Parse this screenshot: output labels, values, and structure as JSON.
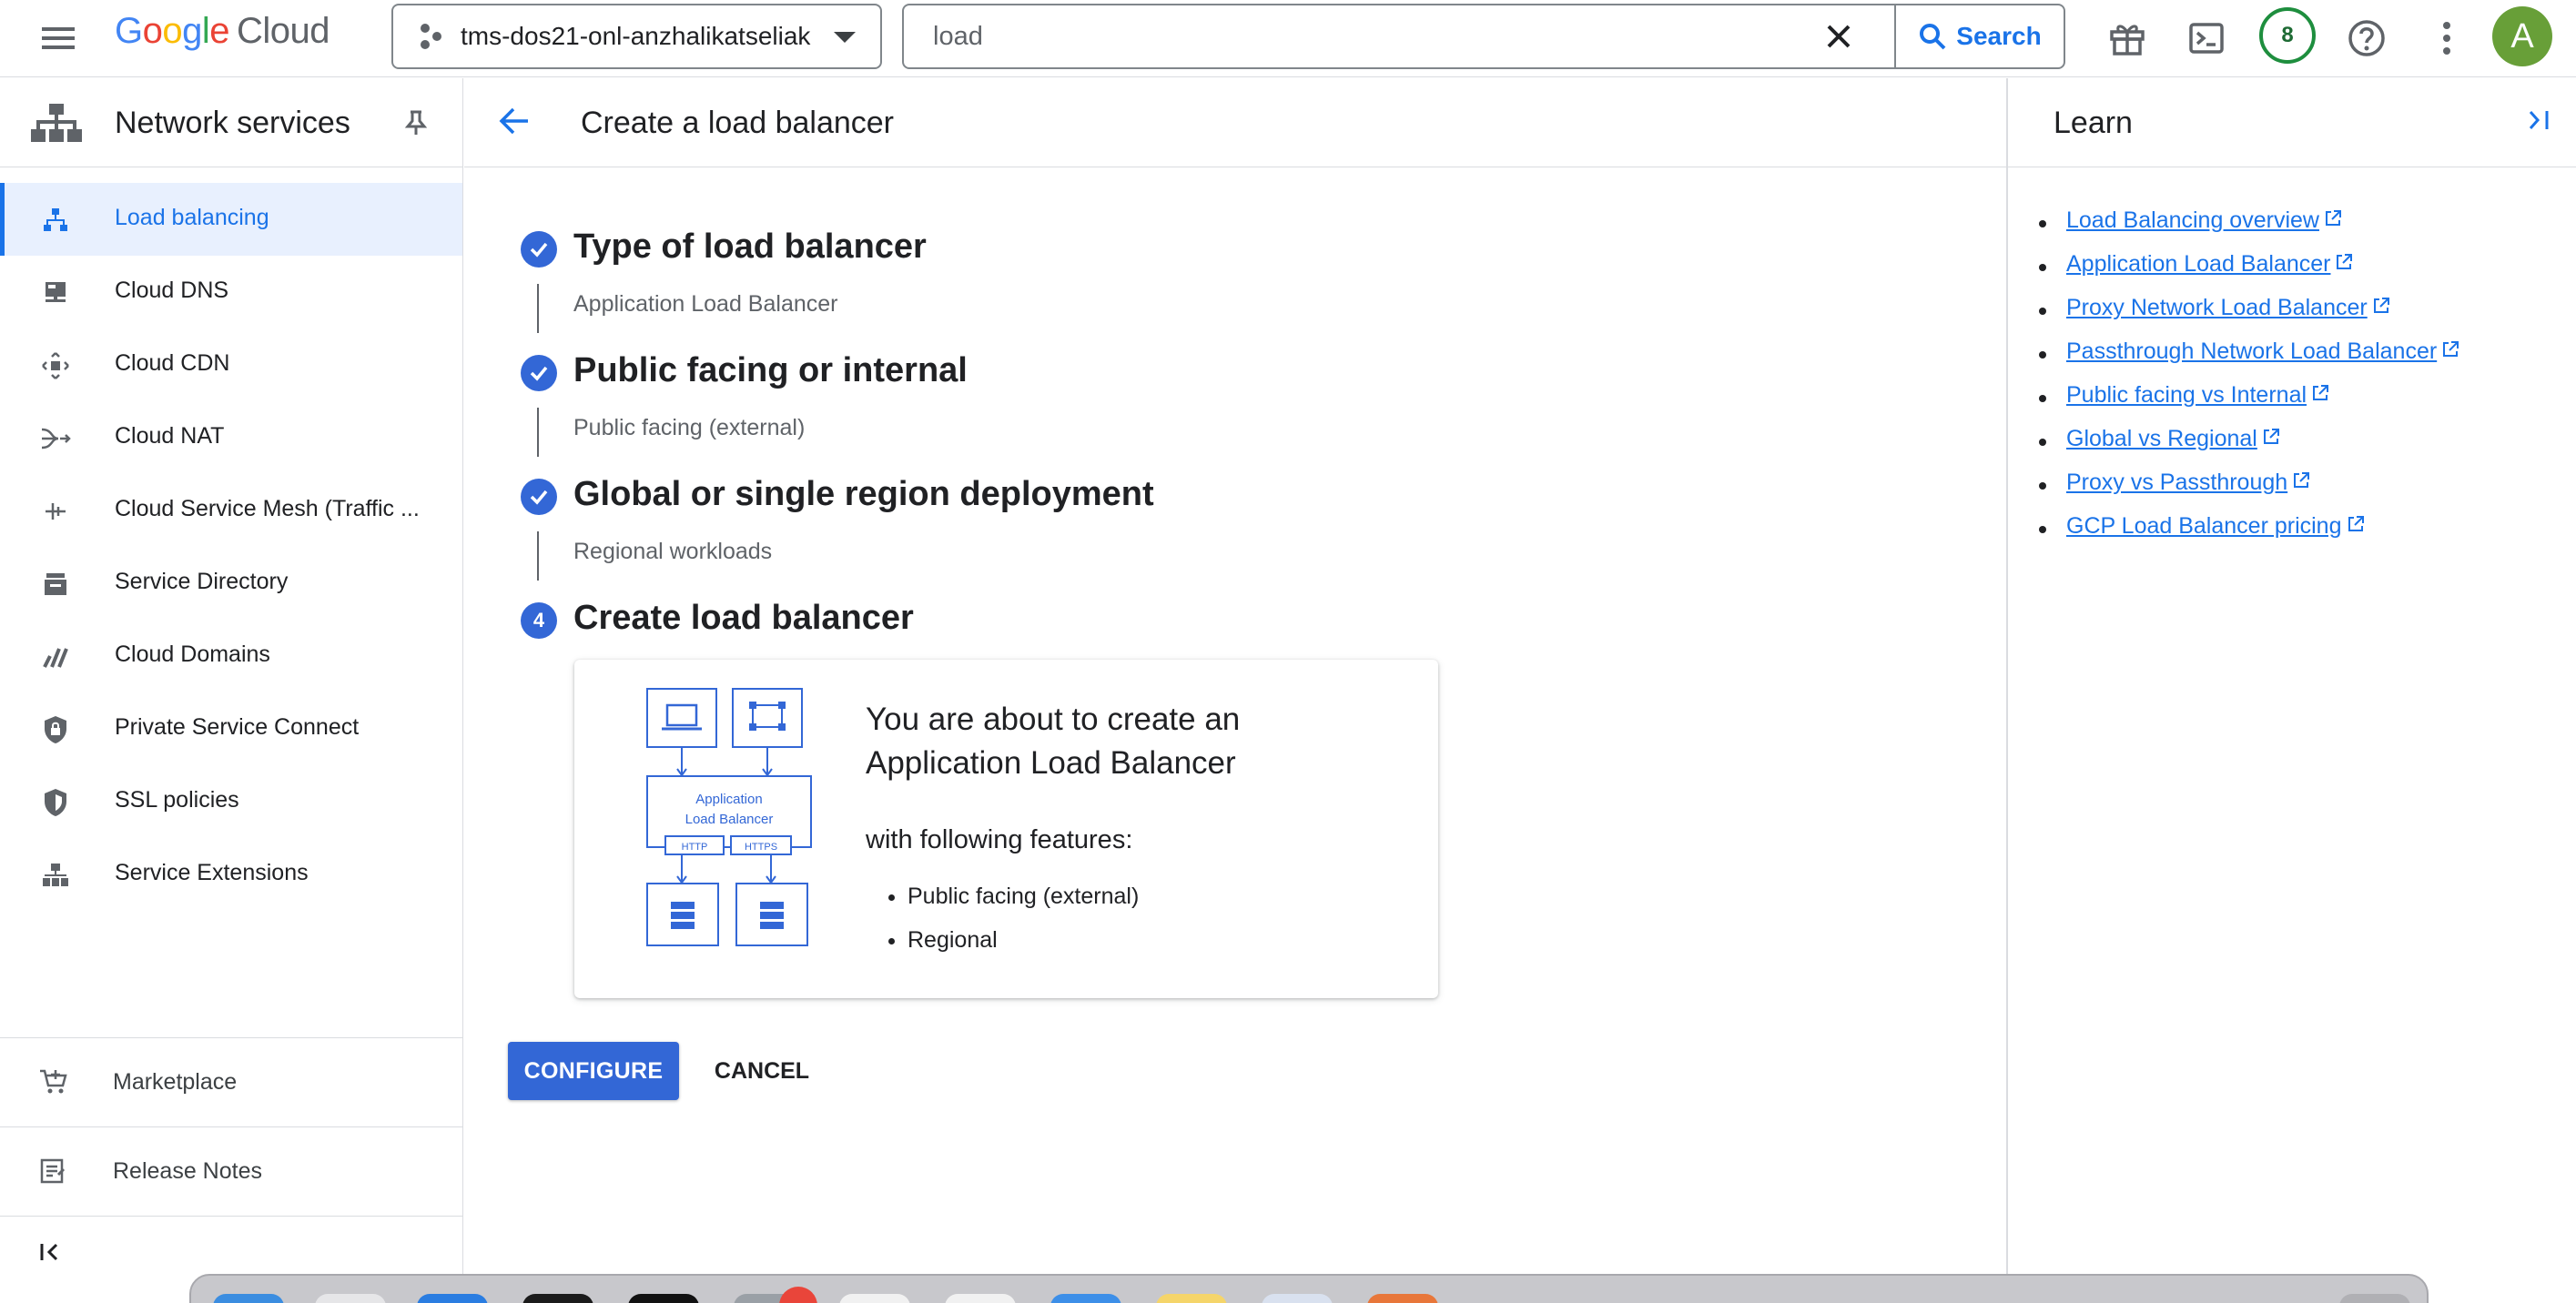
{
  "topbar": {
    "logo_letters": [
      "G",
      "o",
      "o",
      "g",
      "l",
      "e"
    ],
    "logo_suffix": "Cloud",
    "project_name": "tms-dos21-onl-anzhalikatseliak",
    "search_value": "load",
    "search_button": "Search",
    "notification_count": "8",
    "avatar_letter": "A"
  },
  "leftnav": {
    "title": "Network services",
    "items": [
      {
        "label": "Load balancing",
        "icon": "load-balancing-icon",
        "active": true
      },
      {
        "label": "Cloud DNS",
        "icon": "cloud-dns-icon"
      },
      {
        "label": "Cloud CDN",
        "icon": "cloud-cdn-icon"
      },
      {
        "label": "Cloud NAT",
        "icon": "cloud-nat-icon"
      },
      {
        "label": "Cloud Service Mesh (Traffic ...",
        "icon": "service-mesh-icon"
      },
      {
        "label": "Service Directory",
        "icon": "service-directory-icon"
      },
      {
        "label": "Cloud Domains",
        "icon": "cloud-domains-icon"
      },
      {
        "label": "Private Service Connect",
        "icon": "private-service-connect-icon"
      },
      {
        "label": "SSL policies",
        "icon": "ssl-policies-icon"
      },
      {
        "label": "Service Extensions",
        "icon": "service-extensions-icon"
      }
    ],
    "marketplace": "Marketplace",
    "release_notes": "Release Notes"
  },
  "main": {
    "title": "Create a load balancer",
    "steps": [
      {
        "title": "Type of load balancer",
        "subtitle": "Application Load Balancer",
        "status": "done"
      },
      {
        "title": "Public facing or internal",
        "subtitle": "Public facing (external)",
        "status": "done"
      },
      {
        "title": "Global or single region deployment",
        "subtitle": "Regional workloads",
        "status": "done"
      },
      {
        "title": "Create load balancer",
        "number": "4",
        "status": "current"
      }
    ],
    "card": {
      "title": "You are about to create an Application Load Balancer",
      "features_label": "with following features:",
      "features": [
        "Public facing (external)",
        "Regional"
      ],
      "diagram": {
        "lb_line1": "Application",
        "lb_line2": "Load Balancer",
        "proto1": "HTTP",
        "proto2": "HTTPS"
      }
    },
    "configure_button": "CONFIGURE",
    "cancel_button": "CANCEL"
  },
  "learn": {
    "title": "Learn",
    "links": [
      "Load Balancing overview",
      "Application Load Balancer",
      "Proxy Network Load Balancer",
      "Passthrough Network Load Balancer",
      "Public facing vs Internal",
      "Global vs Regional",
      "Proxy vs Passthrough",
      "GCP Load Balancer pricing"
    ]
  },
  "colors": {
    "accent": "#1a73e8",
    "step_circle": "#3367d6",
    "active_nav_bg": "#e8f0fe",
    "notification_ring": "#1e8e3e",
    "avatar_bg": "#689f38"
  }
}
